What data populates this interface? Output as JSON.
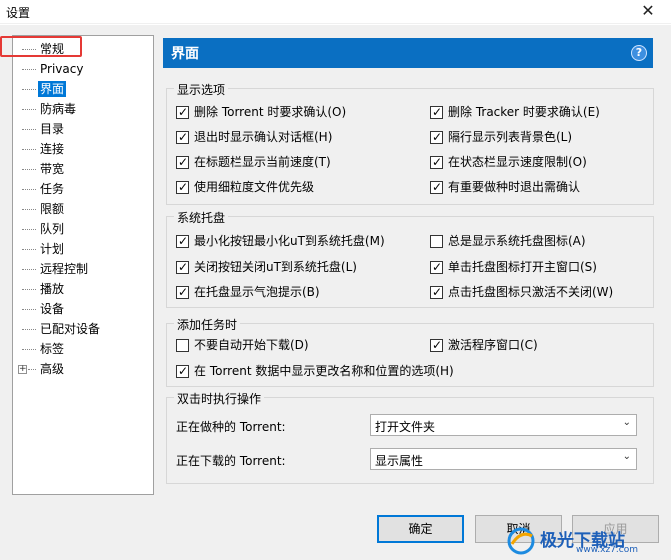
{
  "window": {
    "title": "设置",
    "close_glyph": "✕"
  },
  "tree": {
    "items": [
      {
        "label": "常规",
        "selected": false
      },
      {
        "label": "Privacy",
        "selected": false
      },
      {
        "label": "界面",
        "selected": true
      },
      {
        "label": "防病毒",
        "selected": false
      },
      {
        "label": "目录",
        "selected": false
      },
      {
        "label": "连接",
        "selected": false
      },
      {
        "label": "带宽",
        "selected": false
      },
      {
        "label": "任务",
        "selected": false
      },
      {
        "label": "限额",
        "selected": false
      },
      {
        "label": "队列",
        "selected": false
      },
      {
        "label": "计划",
        "selected": false
      },
      {
        "label": "远程控制",
        "selected": false
      },
      {
        "label": "播放",
        "selected": false
      },
      {
        "label": "设备",
        "selected": false
      },
      {
        "label": "已配对设备",
        "selected": false
      },
      {
        "label": "标签",
        "selected": false
      },
      {
        "label": "高级",
        "selected": false,
        "expandable": true
      }
    ],
    "expand_glyph": "+"
  },
  "panel": {
    "title": "界面",
    "help_glyph": "?"
  },
  "display": {
    "title": "显示选项",
    "options": [
      {
        "label": "删除 Torrent 时要求确认(O)",
        "checked": true
      },
      {
        "label": "删除 Tracker 时要求确认(E)",
        "checked": true
      },
      {
        "label": "退出时显示确认对话框(H)",
        "checked": true
      },
      {
        "label": "隔行显示列表背景色(L)",
        "checked": true
      },
      {
        "label": "在标题栏显示当前速度(T)",
        "checked": true
      },
      {
        "label": "在状态栏显示速度限制(O)",
        "checked": true
      },
      {
        "label": "使用细粒度文件优先级",
        "checked": true
      },
      {
        "label": "有重要做种时退出需确认",
        "checked": true
      }
    ]
  },
  "tray": {
    "title": "系统托盘",
    "options": [
      {
        "label": "最小化按钮最小化uT到系统托盘(M)",
        "checked": true
      },
      {
        "label": "总是显示系统托盘图标(A)",
        "checked": false
      },
      {
        "label": "关闭按钮关闭uT到系统托盘(L)",
        "checked": true
      },
      {
        "label": "单击托盘图标打开主窗口(S)",
        "checked": true
      },
      {
        "label": "在托盘显示气泡提示(B)",
        "checked": true
      },
      {
        "label": "点击托盘图标只激活不关闭(W)",
        "checked": true
      }
    ]
  },
  "addtask": {
    "title": "添加任务时",
    "options": [
      {
        "label": "不要自动开始下载(D)",
        "checked": false
      },
      {
        "label": "激活程序窗口(C)",
        "checked": true
      },
      {
        "label": "在 Torrent 数据中显示更改名称和位置的选项(H)",
        "checked": true
      }
    ]
  },
  "dblclick": {
    "title": "双击时执行操作",
    "seeding_label": "正在做种的 Torrent:",
    "seeding_value": "打开文件夹",
    "downloading_label": "正在下载的 Torrent:",
    "downloading_value": "显示属性",
    "arrow_glyph": "⌄"
  },
  "buttons": {
    "ok": "确定",
    "cancel": "取消",
    "apply": "应用"
  },
  "watermark": {
    "text": "极光下载站",
    "url": "www.xz7.com"
  },
  "colors": {
    "accent": "#0a6fc2",
    "selection": "#0078d7",
    "highlight": "#e53935"
  }
}
